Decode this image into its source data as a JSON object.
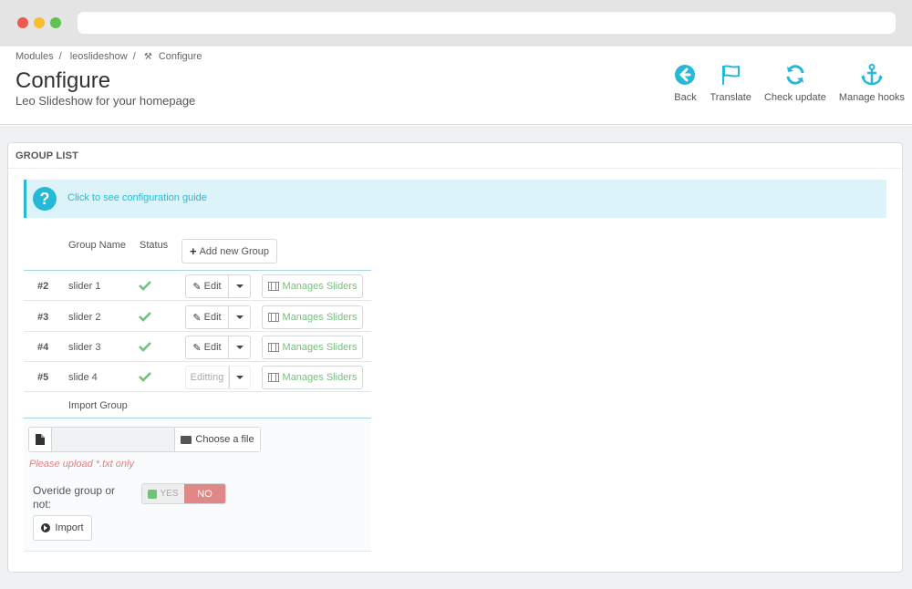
{
  "breadcrumb": {
    "items": [
      "Modules",
      "leoslideshow",
      "Configure"
    ]
  },
  "header": {
    "title": "Configure",
    "subtitle": "Leo Slideshow for your homepage"
  },
  "toolbar": {
    "back": {
      "label": "Back",
      "icon": "back-circle-icon"
    },
    "translate": {
      "label": "Translate",
      "icon": "flag-icon"
    },
    "check_update": {
      "label": "Check update",
      "icon": "refresh-icon"
    },
    "manage_hooks": {
      "label": "Manage hooks",
      "icon": "anchor-icon"
    }
  },
  "colors": {
    "accent": "#25b9d7",
    "success": "#72c279",
    "danger": "#e08788"
  },
  "panel": {
    "title": "GROUP LIST"
  },
  "guide": {
    "link_text": "Click to see configuration guide",
    "icon": "question-icon"
  },
  "table": {
    "headers": {
      "name": "Group Name",
      "status": "Status"
    },
    "add_button": "Add new Group",
    "rows": [
      {
        "id": "#2",
        "name": "slider 1",
        "edit_label": "Edit",
        "manage_label": "Manages Sliders"
      },
      {
        "id": "#3",
        "name": "slider 2",
        "edit_label": "Edit",
        "manage_label": "Manages Sliders"
      },
      {
        "id": "#4",
        "name": "slider 3",
        "edit_label": "Edit",
        "manage_label": "Manages Sliders"
      },
      {
        "id": "#5",
        "name": "slide 4",
        "edit_label": "Editting",
        "manage_label": "Manages Sliders"
      }
    ]
  },
  "import": {
    "title": "Import Group",
    "choose_file": "Choose a file",
    "note": "Please upload *.txt only",
    "override_label": "Overide group or not:",
    "yes_label": "YES",
    "no_label": "NO",
    "import_button": "Import"
  }
}
